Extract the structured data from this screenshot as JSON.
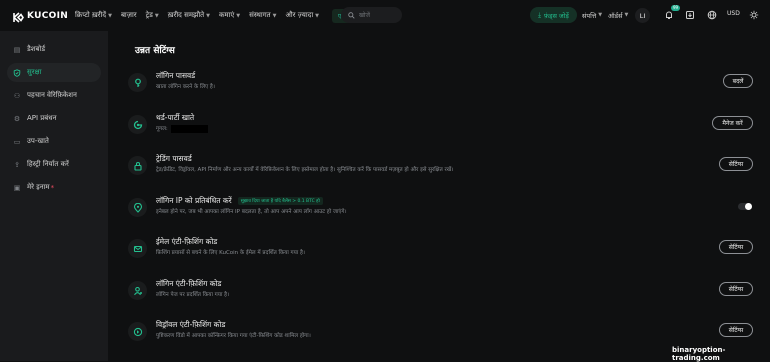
{
  "brand": {
    "name": "KUCOIN",
    "accent": "#23c08f"
  },
  "nav": [
    {
      "label": "क्रिप्टो ख़रीदें",
      "caret": true
    },
    {
      "label": "बाज़ार",
      "caret": false
    },
    {
      "label": "ट्रेड",
      "caret": true
    },
    {
      "label": "ख़रीद समझौते",
      "caret": true
    },
    {
      "label": "कमाएं",
      "caret": true
    },
    {
      "label": "संस्थागत",
      "caret": true
    },
    {
      "label": "और ज़्यादा",
      "caret": true
    }
  ],
  "affiliate_label": "एफ़िलिएट",
  "search": {
    "placeholder": "खोजें",
    "icon": "search-icon"
  },
  "header": {
    "deposit_label": "फ़ंड्स जोड़ें",
    "assets_label": "संपत्ति",
    "orders_label": "ऑर्डर्स",
    "avatar_initials": "LI",
    "notification_badge": "99",
    "currency": "USD"
  },
  "sidebar": {
    "items": [
      {
        "label": "डैशबोर्ड",
        "icon": "dashboard-icon",
        "active": false
      },
      {
        "label": "सुरक्षा",
        "icon": "shield-icon",
        "active": true
      },
      {
        "label": "पहचान वेरिफ़िकेशन",
        "icon": "id-icon",
        "active": false
      },
      {
        "label": "API प्रबंधन",
        "icon": "api-icon",
        "active": false
      },
      {
        "label": "उप-खाते",
        "icon": "sub-account-icon",
        "active": false
      },
      {
        "label": "हिस्ट्री निर्यात करें",
        "icon": "export-icon",
        "active": false
      },
      {
        "label": "मेरे इनाम",
        "icon": "gift-icon",
        "active": false,
        "hot": "*"
      }
    ]
  },
  "main": {
    "title": "उन्नत सेटिंग्स",
    "rows": [
      {
        "title": "लॉगिन पासवर्ड",
        "desc": "खाता लॉगिन करने के लिए है।",
        "button": "बदलें",
        "icon": "key-icon"
      },
      {
        "title": "थर्ड-पार्टी खाते",
        "desc": "गूगल:",
        "button": "मैनेज करें",
        "icon": "link-icon"
      },
      {
        "title": "ट्रेडिंग पासवर्ड",
        "desc": "ट्रेड/क्रेडिट, विड्रॉवल, API निर्माण और अन्य कार्यों में वेरिफ़िकेशन के लिए इस्तेमाल होता है। सुनिश्चित करें कि पासवर्ड मज़बूत हो और इसे सुरक्षित रखें।",
        "button": "सेटिंग्स",
        "icon": "lock-icon"
      },
      {
        "title": "लॉगिन IP को प्रतिबंधित करें",
        "tag": "सुझाव दिया जाता है यदि बैलेंस > 0.1 BTC हो",
        "desc": "इनेबल होने पर, जब भी आपका लॉगिन IP बदलता है, तो आप अपने आप लॉग आउट हो जाएंगे।",
        "toggle_on": true,
        "icon": "location-icon"
      },
      {
        "title": "ईमेल एंटी-फ़िशिंग कोड",
        "desc": "फ़िशिंग प्रयासों से बचने के लिए KuCoin के ईमेल में प्रदर्शित किया गया है।",
        "button": "सेटिंग्स",
        "icon": "mail-icon"
      },
      {
        "title": "लॉगिन एंटी-फ़िशिंग कोड",
        "desc": "लॉगिन पेज पर प्रदर्शित किया गया है।",
        "button": "सेटिंग्स",
        "icon": "user-icon"
      },
      {
        "title": "विड्रॉवल एंटी-फ़िशिंग कोड",
        "desc": "पुष्टिकरण विंडो में आपका कॉन्फ़िगर किया गया एंटी-फ़िशिंग कोड शामिल होगा।",
        "button": "सेटिंग्स",
        "icon": "withdraw-icon"
      }
    ]
  },
  "watermark": "binaryoption-trading.com"
}
